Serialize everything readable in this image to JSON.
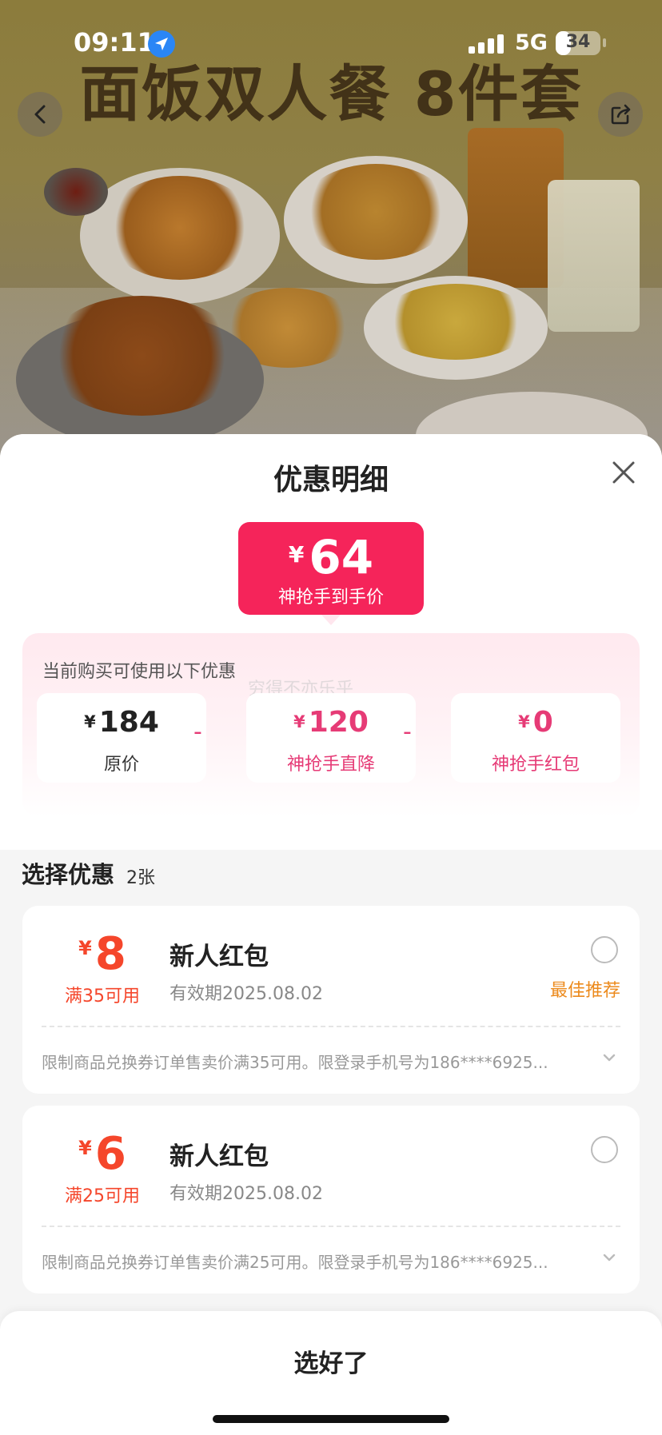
{
  "status_bar": {
    "time": "09:11",
    "network": "5G",
    "battery": "34",
    "battery_level": 0.34
  },
  "hero": {
    "banner_title": "面饭双人餐 8件套"
  },
  "sheet": {
    "title": "优惠明细",
    "final_price": {
      "currency": "¥",
      "value": "64",
      "label": "神抢手到手价"
    },
    "discount_caption": "当前购买可使用以下优惠",
    "watermark": "穷得不亦乐乎",
    "breakdown": [
      {
        "currency": "¥",
        "value": "184",
        "label": "原价"
      },
      {
        "currency": "¥",
        "value": "120",
        "label": "神抢手直降"
      },
      {
        "currency": "¥",
        "value": "0",
        "label": "神抢手红包"
      }
    ],
    "operator": "-",
    "select": {
      "title": "选择优惠",
      "count": "2张"
    },
    "coupons": [
      {
        "currency": "¥",
        "amount": "8",
        "condition": "满35可用",
        "name": "新人红包",
        "validity": "有效期2025.08.02",
        "badge": "最佳推荐",
        "rule": "限制商品兑换券订单售卖价满35可用。限登录手机号为186****6925..."
      },
      {
        "currency": "¥",
        "amount": "6",
        "condition": "满25可用",
        "name": "新人红包",
        "validity": "有效期2025.08.02",
        "badge": "",
        "rule": "限制商品兑换券订单售卖价满25可用。限登录手机号为186****6925..."
      }
    ],
    "confirm_label": "选好了"
  },
  "colors": {
    "accent_pink": "#f5245a",
    "coupon_red": "#f5462b",
    "best_orange": "#ec8a1c",
    "discount_pink": "#e63b76"
  },
  "icons": {
    "back": "chevron-left-icon",
    "share": "share-icon",
    "close": "close-icon",
    "location": "location-arrow-icon",
    "expand": "chevron-down-icon"
  }
}
